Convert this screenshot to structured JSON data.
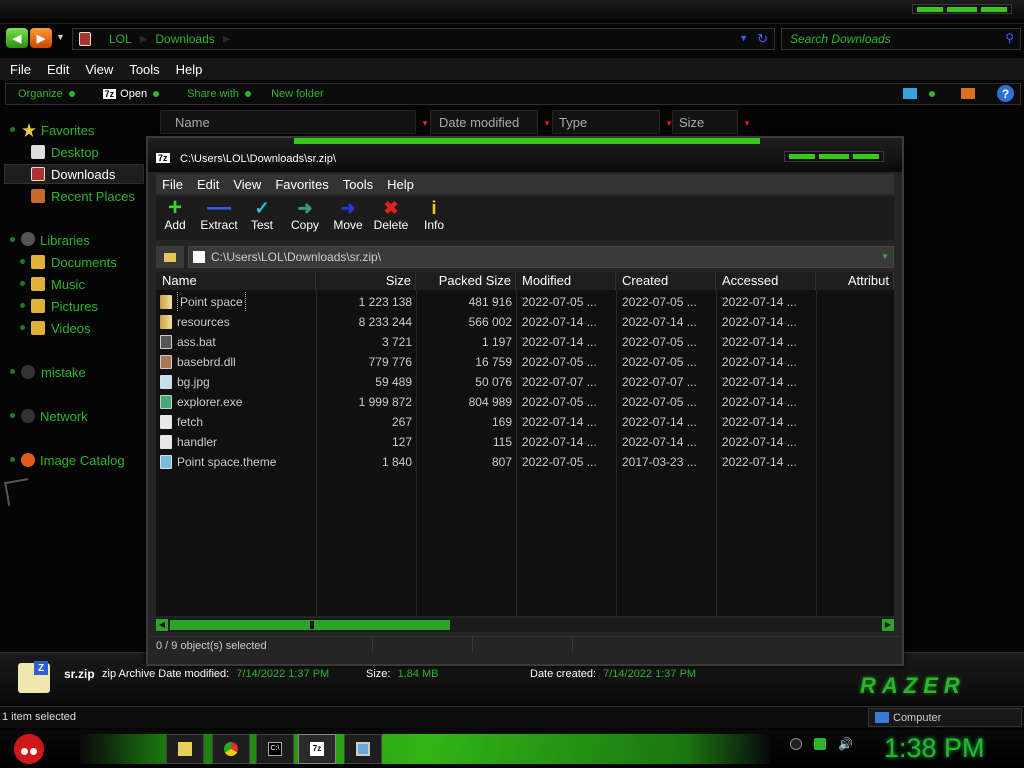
{
  "explorer": {
    "breadcrumb": [
      "LOL",
      "Downloads"
    ],
    "search_placeholder": "Search Downloads",
    "menu": [
      "File",
      "Edit",
      "View",
      "Tools",
      "Help"
    ],
    "commands": {
      "organize": "Organize",
      "open": "Open",
      "open_badge": "7z",
      "share": "Share with",
      "new_folder": "New folder"
    },
    "help_glyph": "?",
    "nav": {
      "favorites": "Favorites",
      "desktop": "Desktop",
      "downloads": "Downloads",
      "recent": "Recent Places",
      "libraries": "Libraries",
      "documents": "Documents",
      "music": "Music",
      "pictures": "Pictures",
      "videos": "Videos",
      "mistake": "mistake",
      "network": "Network",
      "image_catalog": "Image Catalog"
    },
    "columns": [
      "Name",
      "Date modified",
      "Type",
      "Size"
    ],
    "details": {
      "name": "sr.zip",
      "type": "zip Archive",
      "modified_label": "Date modified:",
      "modified": "7/14/2022 1:37 PM",
      "size_label": "Size:",
      "size": "1.84 MB",
      "created_label": "Date created:",
      "created": "7/14/2022 1:37 PM",
      "logo_text": "RAZER"
    },
    "status_left": "1 item selected",
    "status_right": "Computer"
  },
  "sevenzip": {
    "title": "C:\\Users\\LOL\\Downloads\\sr.zip\\",
    "title_icon": "7z",
    "menu": [
      "File",
      "Edit",
      "View",
      "Favorites",
      "Tools",
      "Help"
    ],
    "toolbar": {
      "add": "Add",
      "extract": "Extract",
      "test": "Test",
      "copy": "Copy",
      "move": "Move",
      "delete": "Delete",
      "info": "Info"
    },
    "path": "C:\\Users\\LOL\\Downloads\\sr.zip\\",
    "columns": {
      "name": "Name",
      "size": "Size",
      "packed": "Packed Size",
      "modified": "Modified",
      "created": "Created",
      "accessed": "Accessed",
      "attributes": "Attribut"
    },
    "rows": [
      {
        "name": "Point space",
        "icon": "folder",
        "size": "1 223 138",
        "packed": "481 916",
        "modified": "2022-07-05 ...",
        "created": "2022-07-05 ...",
        "accessed": "2022-07-14 ..."
      },
      {
        "name": "resources",
        "icon": "folder",
        "size": "8 233 244",
        "packed": "566 002",
        "modified": "2022-07-14 ...",
        "created": "2022-07-14 ...",
        "accessed": "2022-07-14 ..."
      },
      {
        "name": "ass.bat",
        "icon": "bat",
        "size": "3 721",
        "packed": "1 197",
        "modified": "2022-07-14 ...",
        "created": "2022-07-05 ...",
        "accessed": "2022-07-14 ..."
      },
      {
        "name": "basebrd.dll",
        "icon": "dll",
        "size": "779 776",
        "packed": "16 759",
        "modified": "2022-07-05 ...",
        "created": "2022-07-05 ...",
        "accessed": "2022-07-14 ..."
      },
      {
        "name": "bg.jpg",
        "icon": "img",
        "size": "59 489",
        "packed": "50 076",
        "modified": "2022-07-07 ...",
        "created": "2022-07-07 ...",
        "accessed": "2022-07-14 ..."
      },
      {
        "name": "explorer.exe",
        "icon": "exe",
        "size": "1 999 872",
        "packed": "804 989",
        "modified": "2022-07-05 ...",
        "created": "2022-07-05 ...",
        "accessed": "2022-07-14 ..."
      },
      {
        "name": "fetch",
        "icon": "file",
        "size": "267",
        "packed": "169",
        "modified": "2022-07-14 ...",
        "created": "2022-07-14 ...",
        "accessed": "2022-07-14 ..."
      },
      {
        "name": "handler",
        "icon": "file",
        "size": "127",
        "packed": "115",
        "modified": "2022-07-14 ...",
        "created": "2022-07-14 ...",
        "accessed": "2022-07-14 ..."
      },
      {
        "name": "Point space.theme",
        "icon": "theme",
        "size": "1 840",
        "packed": "807",
        "modified": "2022-07-05 ...",
        "created": "2017-03-23 ...",
        "accessed": "2022-07-14 ..."
      }
    ],
    "status": "0 / 9 object(s) selected"
  },
  "taskbar": {
    "apps": [
      "folder-icon",
      "chrome-icon",
      "cmd-icon",
      "sevenzip-icon",
      "display-icon"
    ],
    "cmd_glyph": "C:\\",
    "sevenzip_glyph": "7z",
    "clock": "1:38 PM"
  },
  "colors": {
    "accent": "#2db42d",
    "bright_green": "#39c71c",
    "background": "#050505",
    "delete_red": "#e02020",
    "info_yellow": "#f0d000"
  }
}
